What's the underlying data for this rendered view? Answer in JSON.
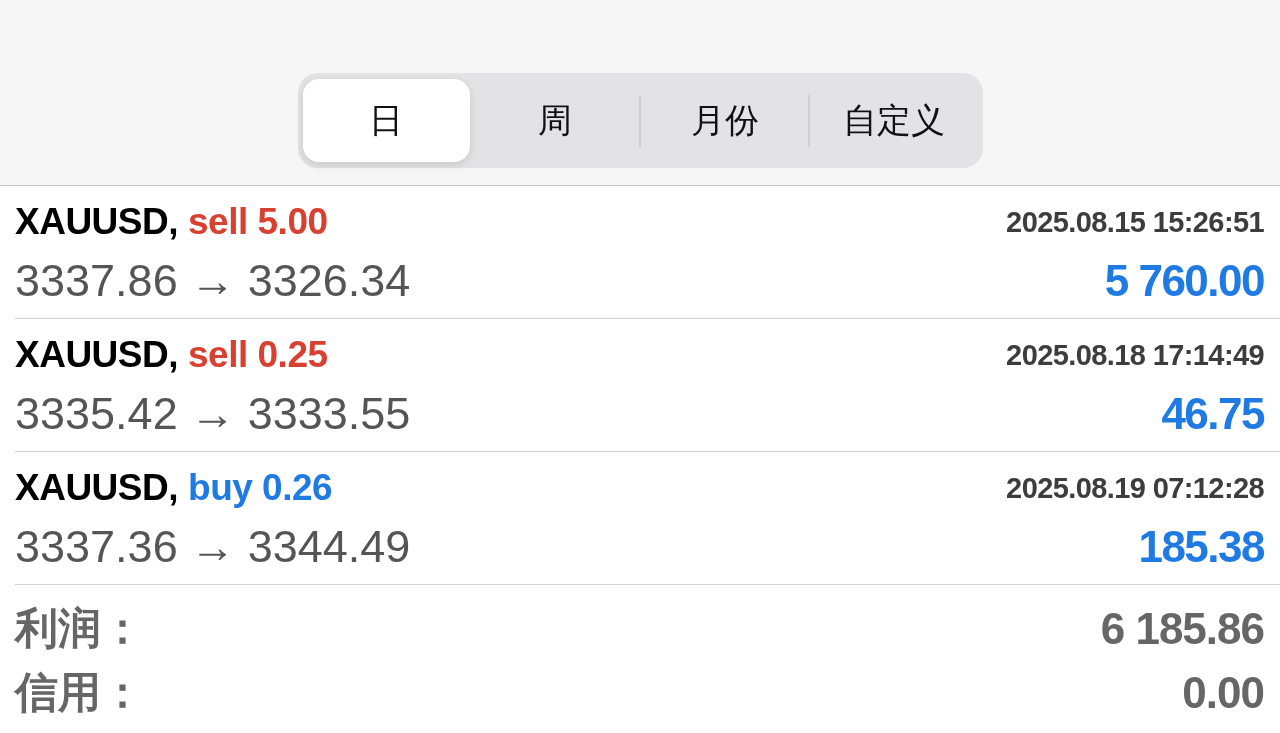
{
  "segments": [
    {
      "label": "日",
      "selected": true
    },
    {
      "label": "周",
      "selected": false
    },
    {
      "label": "月份",
      "selected": false
    },
    {
      "label": "自定义",
      "selected": false
    }
  ],
  "trades": [
    {
      "symbol": "XAUUSD,",
      "kind": "sell",
      "order": "sell 5.00",
      "time": "2025.08.15 15:26:51",
      "prices": "3337.86 → 3326.34",
      "profit": "5 760.00"
    },
    {
      "symbol": "XAUUSD,",
      "kind": "sell",
      "order": "sell 0.25",
      "time": "2025.08.18 17:14:49",
      "prices": "3335.42 → 3333.55",
      "profit": "46.75"
    },
    {
      "symbol": "XAUUSD,",
      "kind": "buy",
      "order": "buy 0.26",
      "time": "2025.08.19 07:12:28",
      "prices": "3337.36 → 3344.49",
      "profit": "185.38"
    }
  ],
  "summary": [
    {
      "label": "利润：",
      "value": "6 185.86"
    },
    {
      "label": "信用：",
      "value": "0.00"
    }
  ]
}
